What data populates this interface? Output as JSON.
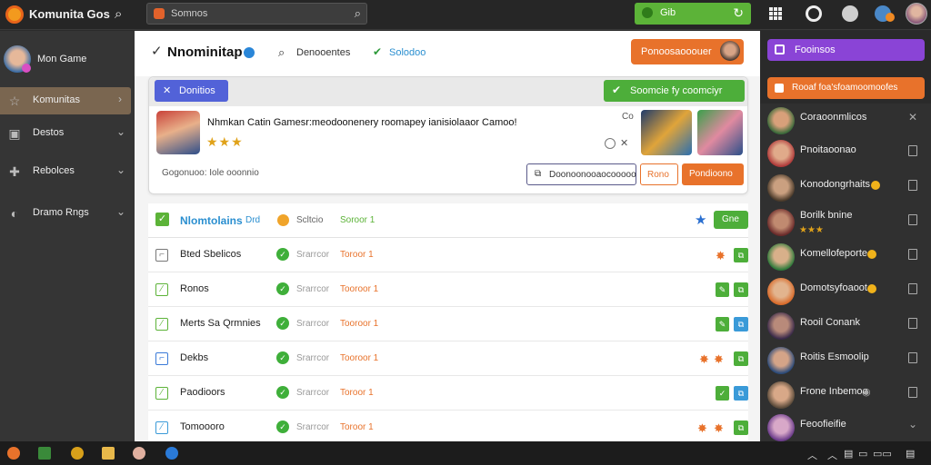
{
  "app": {
    "name": "Komunita Gos"
  },
  "search": {
    "placeholder": "Somnos"
  },
  "topbar": {
    "green_label": "Gib"
  },
  "sidebar": {
    "profile_name": "Mon Game",
    "items": [
      {
        "label": "Komunitas",
        "icon": "star-icon",
        "active": true
      },
      {
        "label": "Destos",
        "icon": "box-icon",
        "active": false
      },
      {
        "label": "Rebolces",
        "icon": "gamepad-icon",
        "active": false
      },
      {
        "label": "Dramo Rngs",
        "icon": "settings-icon",
        "active": false
      }
    ]
  },
  "header": {
    "title": "Nnominitap",
    "tab1": "Denooentes",
    "tab2": "Solodoo",
    "cta": "Ponoosaooouer"
  },
  "card": {
    "chip": "Donitios",
    "green_chip": "Soomcie fy coomciyr",
    "description": "Nhmkan Catin Gamesr:meodoonenery roomapey  ianisiolaaor Camoo!",
    "rating_stars": "★★★",
    "rating_value": 3,
    "edit": "Co",
    "meta": "Gogonuoo: Iole ooonnio",
    "btn_outline": "Doonoonooaocooooo",
    "btn_small": "Rono",
    "btn_primary": "Pondioono"
  },
  "list": {
    "header": {
      "title": "Nlomtolains",
      "sub": "Drd",
      "col1": "Scltcio",
      "col2": "Soroor 1",
      "btn": "Gne"
    },
    "rows": [
      {
        "name": "Bted Sbelicos",
        "c1": "Srarrcor",
        "c2": "Toroor 1"
      },
      {
        "name": "Ronos",
        "c1": "Srarrcor",
        "c2": "Tooroor 1"
      },
      {
        "name": "Merts Sa Qrmnies",
        "c1": "Srarrcor",
        "c2": "Tooroor 1"
      },
      {
        "name": "Dekbs",
        "c1": "Srarrcor",
        "c2": "Tooroor 1"
      },
      {
        "name": "Paodioors",
        "c1": "Srarrcor",
        "c2": "Toroor 1"
      },
      {
        "name": "Tomoooro",
        "c1": "Srarrcor",
        "c2": "Toroor 1"
      }
    ]
  },
  "right_panel": {
    "purple_label": "Fooinsos",
    "orange_label": "Rooaf foa'sfoamoomoofes",
    "friends": [
      {
        "name": "Coraoonmlicos"
      },
      {
        "name": "Pnoitaoonao"
      },
      {
        "name": "Konodongrhaits"
      },
      {
        "name": "Borilk bnine",
        "stars": "★★★"
      },
      {
        "name": "Komellofeporte"
      },
      {
        "name": "Domotsyfoaoot"
      },
      {
        "name": "Rooil Conank"
      },
      {
        "name": "Roitis Esmoolip"
      },
      {
        "name": "Frone Inbemoo"
      },
      {
        "name": "Feoofieifie"
      }
    ]
  },
  "colors": {
    "accent_green": "#5cb338",
    "accent_orange": "#e8722b",
    "accent_blue": "#2b8fd0",
    "accent_purple": "#8a44d6"
  }
}
